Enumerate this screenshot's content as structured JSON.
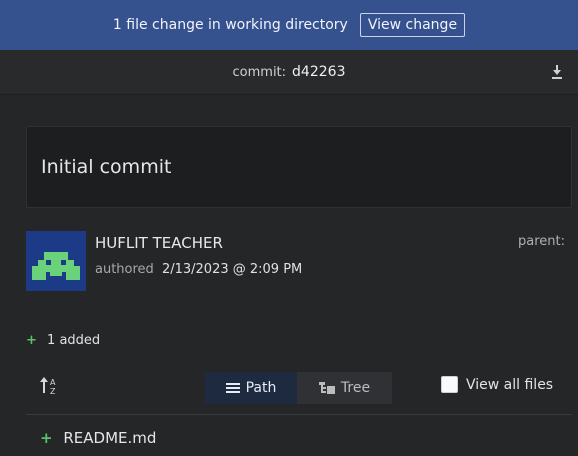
{
  "banner": {
    "message": "1 file change in working directory",
    "button": "View change"
  },
  "commit": {
    "label": "commit:",
    "sha": "d42263"
  },
  "message": "Initial commit",
  "author": {
    "name": "HUFLIT TEACHER",
    "authored_label": "authored",
    "date": "2/13/2023 @ 2:09 PM",
    "parent_label": "parent:"
  },
  "changes": {
    "added_symbol": "+",
    "added_text": "1 added"
  },
  "toolbar": {
    "path_label": "Path",
    "tree_label": "Tree",
    "view_all": "View all files"
  },
  "files": [
    {
      "symbol": "+",
      "name": "README.md"
    }
  ],
  "colors": {
    "banner": "#35528f",
    "added": "#59c36a",
    "avatar_bg": "#1c3a86",
    "avatar_fg": "#6ad27b"
  },
  "icons": [
    "download-icon",
    "sort-az-icon",
    "list-icon",
    "tree-icon"
  ]
}
